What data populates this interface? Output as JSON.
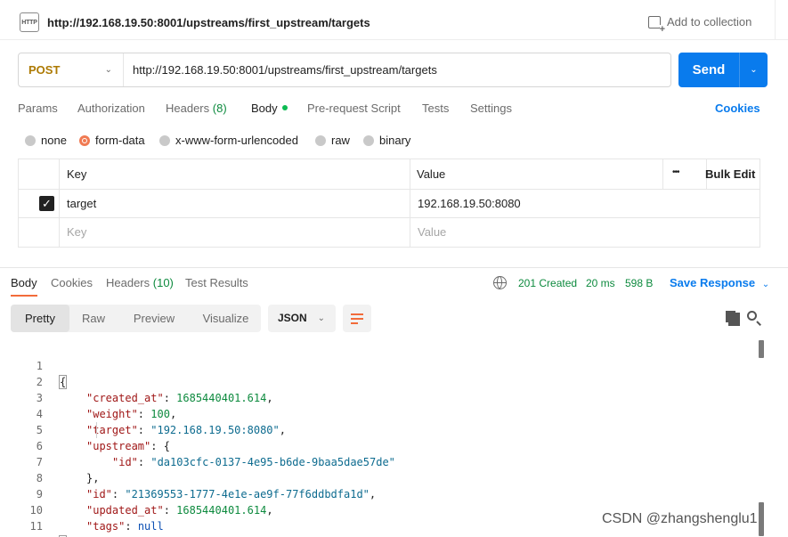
{
  "request": {
    "icon_text": "HTTP",
    "title": "http://192.168.19.50:8001/upstreams/first_upstream/targets",
    "add_to_collection": "Add to collection",
    "method": "POST",
    "url": "http://192.168.19.50:8001/upstreams/first_upstream/targets",
    "send_label": "Send"
  },
  "request_tabs": {
    "params": "Params",
    "authorization": "Authorization",
    "headers": "Headers",
    "headers_count": "(8)",
    "body": "Body",
    "prerequest": "Pre-request Script",
    "tests": "Tests",
    "settings": "Settings",
    "cookies": "Cookies"
  },
  "body_modes": {
    "none": "none",
    "form_data": "form-data",
    "urlencoded": "x-www-form-urlencoded",
    "raw": "raw",
    "binary": "binary",
    "selected": "form-data"
  },
  "params_table": {
    "col_key": "Key",
    "col_value": "Value",
    "more": "•••",
    "bulk_edit": "Bulk Edit",
    "rows": [
      {
        "key": "target",
        "value": "192.168.19.50:8080",
        "checked": true
      }
    ],
    "placeholder_key": "Key",
    "placeholder_value": "Value"
  },
  "response_tabs": {
    "body": "Body",
    "cookies": "Cookies",
    "headers": "Headers",
    "headers_count": "(10)",
    "test_results": "Test Results"
  },
  "response_status": {
    "status": "201 Created",
    "time": "20 ms",
    "size": "598 B",
    "save_response": "Save Response"
  },
  "view_modes": {
    "pretty": "Pretty",
    "raw": "Raw",
    "preview": "Preview",
    "visualize": "Visualize",
    "format": "JSON"
  },
  "code": {
    "line_numbers": [
      "1",
      "2",
      "3",
      "4",
      "5",
      "6",
      "7",
      "8",
      "9",
      "10",
      "11"
    ],
    "lines": {
      "l1_open": "{",
      "created_at_key": "\"created_at\"",
      "created_at_val": "1685440401.614",
      "weight_key": "\"weight\"",
      "weight_val": "100",
      "target_key": "\"target\"",
      "target_val": "\"192.168.19.50:8080\"",
      "upstream_key": "\"upstream\"",
      "upstream_open": "{",
      "up_id_key": "\"id\"",
      "up_id_val": "\"da103cfc-0137-4e95-b6de-9baa5dae57de\"",
      "upstream_close": "},",
      "id_key": "\"id\"",
      "id_val": "\"21369553-1777-4e1e-ae9f-77f6ddbdfa1d\"",
      "updated_at_key": "\"updated_at\"",
      "updated_at_val": "1685440401.614",
      "tags_key": "\"tags\"",
      "tags_val": "null",
      "l11_close": "}"
    }
  },
  "watermark": "CSDN @zhangshenglu1"
}
